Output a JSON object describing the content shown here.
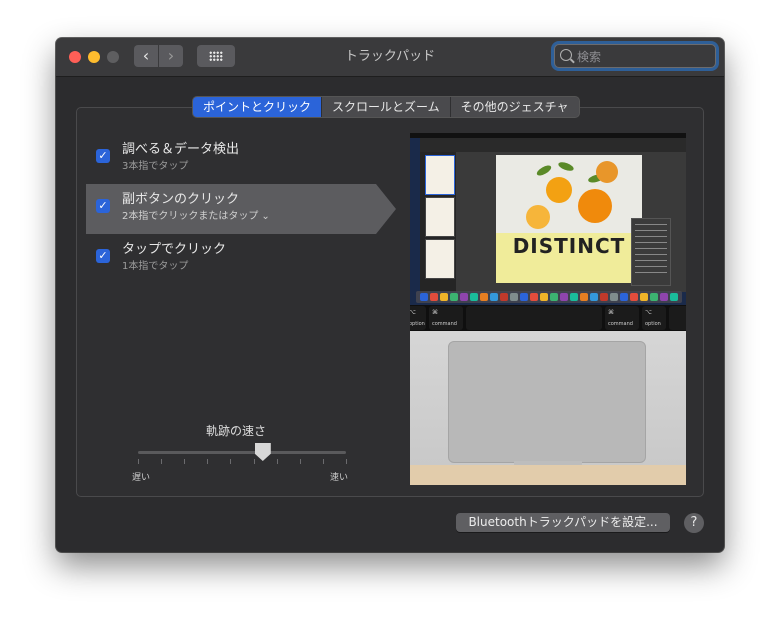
{
  "window": {
    "title": "トラックパッド"
  },
  "toolbar": {
    "back_glyph": "‹",
    "forward_glyph": "›"
  },
  "search": {
    "placeholder": "検索"
  },
  "tabs": [
    {
      "label": "ポイントとクリック",
      "active": true
    },
    {
      "label": "スクロールとズーム",
      "active": false
    },
    {
      "label": "その他のジェスチャ",
      "active": false
    }
  ],
  "options": [
    {
      "title": "調べる＆データ検出",
      "subtitle": "3本指でタップ",
      "checked": true
    },
    {
      "title": "副ボタンのクリック",
      "subtitle": "2本指でクリックまたはタップ",
      "checked": true,
      "selected": true
    },
    {
      "title": "タップでクリック",
      "subtitle": "1本指でタップ",
      "checked": true
    }
  ],
  "tracking_speed": {
    "label": "軌跡の速さ",
    "min_label": "遅い",
    "max_label": "速い",
    "value_fraction": 0.6
  },
  "preview": {
    "doc_headline": "DISTINCT",
    "keys": {
      "command_left": "command",
      "command_right": "command",
      "option_left": "option",
      "option_right": "option",
      "cmd_symbol": "⌘",
      "alt_symbol": "⌥"
    }
  },
  "bluetooth_button": {
    "label": "Bluetoothトラックパッドを設定..."
  },
  "help_button": {
    "label": "?"
  },
  "colors": {
    "accent": "#2b64d9",
    "window_bg": "#2c2c2e",
    "selected_row": "#5c5c5f"
  }
}
